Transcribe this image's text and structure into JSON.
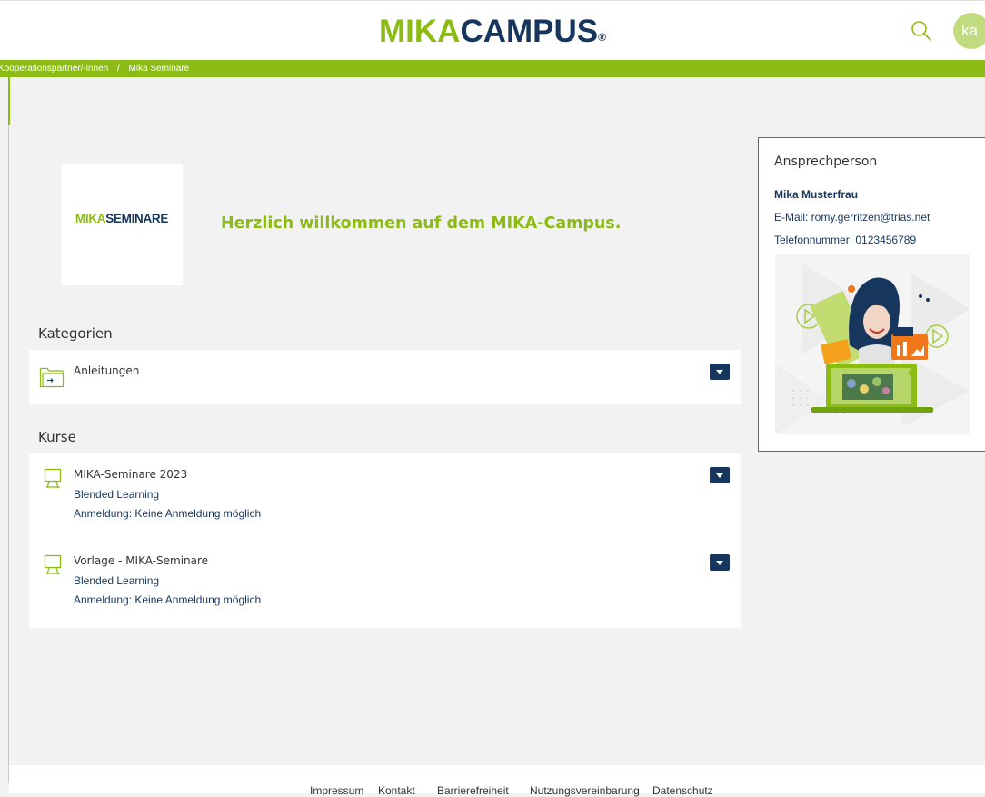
{
  "header": {
    "logo_part1": "MIKA",
    "logo_part2": "CAMPUS",
    "logo_reg": "®",
    "avatar_initials": "ka"
  },
  "breadcrumb": {
    "item1": "Kooperationspartner/-innen",
    "separator": "/",
    "item2": "Mika Seminare"
  },
  "logo_tile": {
    "part1": "MIKA",
    "part2": "SEMINARE"
  },
  "welcome": "Herzlich willkommen auf dem MIKA-Campus.",
  "categories": {
    "title": "Kategorien",
    "items": [
      {
        "label": "Anleitungen",
        "icon": "folder-icon"
      }
    ]
  },
  "courses": {
    "title": "Kurse",
    "items": [
      {
        "title": "MIKA-Seminare 2023",
        "type": "Blended Learning",
        "registration": "Anmeldung: Keine Anmeldung möglich",
        "icon": "presentation-icon"
      },
      {
        "title": "Vorlage - MIKA-Seminare",
        "type": "Blended Learning",
        "registration": "Anmeldung: Keine Anmeldung möglich",
        "icon": "presentation-icon"
      }
    ]
  },
  "contact": {
    "title": "Ansprechperson",
    "name": "Mika Musterfrau",
    "email": "E-Mail: romy.gerritzen@trias.net",
    "phone": "Telefonnummer: 0123456789"
  },
  "footer": {
    "links": [
      "Impressum",
      "Kontakt",
      "Barrierefreiheit",
      "Nutzungsvereinbarung",
      "Datenschutz"
    ]
  },
  "colors": {
    "brand_green": "#8cbb13",
    "brand_navy": "#17365d",
    "avatar_bg": "#c1dc7e"
  }
}
